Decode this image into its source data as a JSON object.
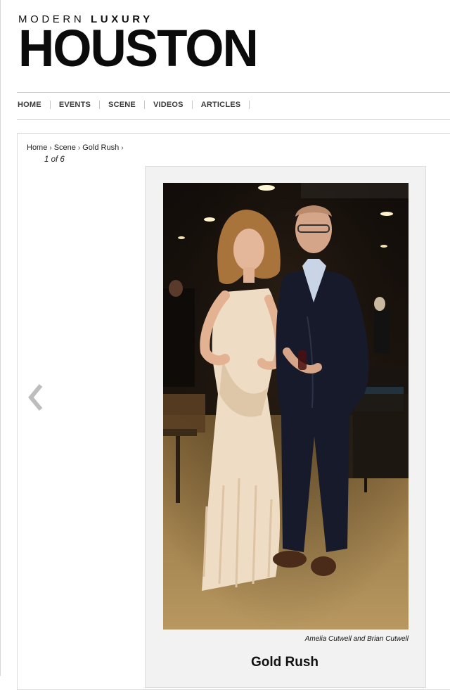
{
  "masthead": {
    "top_word_1": "MODERN",
    "top_word_2": "LUXURY",
    "city": "HOUSTON"
  },
  "nav": {
    "items": [
      {
        "label": "HOME"
      },
      {
        "label": "EVENTS"
      },
      {
        "label": "SCENE"
      },
      {
        "label": "VIDEOS"
      },
      {
        "label": "ARTICLES"
      }
    ]
  },
  "breadcrumb": {
    "items": [
      "Home",
      "Scene",
      "Gold Rush"
    ],
    "separator": "›"
  },
  "gallery": {
    "counter": "1 of 6",
    "caption": "Amelia Cutwell and Brian Cutwell",
    "title": "Gold Rush",
    "prev_icon": "chevron-left-icon"
  },
  "colors": {
    "card_bg": "#f2f2f2",
    "arrow": "#bdbdbd",
    "nav_text": "#3a3a3a"
  }
}
